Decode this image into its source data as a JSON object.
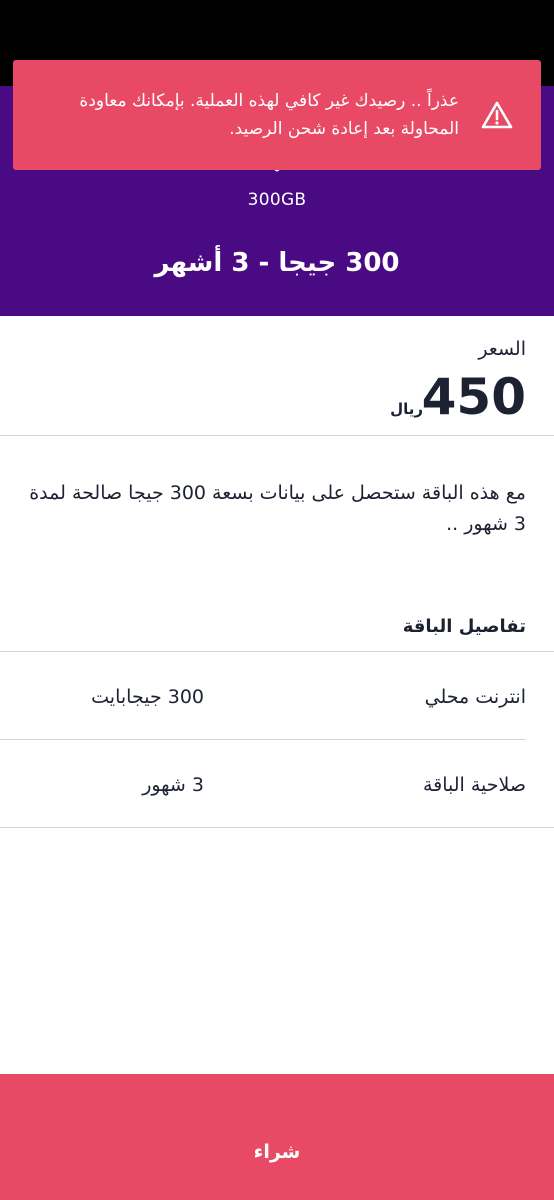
{
  "hero": {
    "data_amount": "300GB",
    "title": "300 جيجا - 3 أشهر"
  },
  "alert": {
    "message": "عذراً .. رصيدك غير كافي لهذه العملية. بإمكانك معاودة المحاولة بعد إعادة شحن الرصيد.",
    "icon": "warning-icon"
  },
  "price": {
    "label": "السعر",
    "value": "450",
    "currency": "ريال"
  },
  "description": "مع هذه الباقة ستحصل على بيانات بسعة 300 جيجا صالحة لمدة 3 شهور ..",
  "details": {
    "title": "تفاصيل الباقة",
    "rows": [
      {
        "label": "انترنت محلي",
        "value": "300 جيجابايت"
      },
      {
        "label": "صلاحية الباقة",
        "value": "3 شهور"
      }
    ]
  },
  "buy_button": {
    "label": "شراء"
  },
  "colors": {
    "hero_background": "#4a0a84",
    "accent": "#e84a66",
    "text": "#1d2233"
  }
}
